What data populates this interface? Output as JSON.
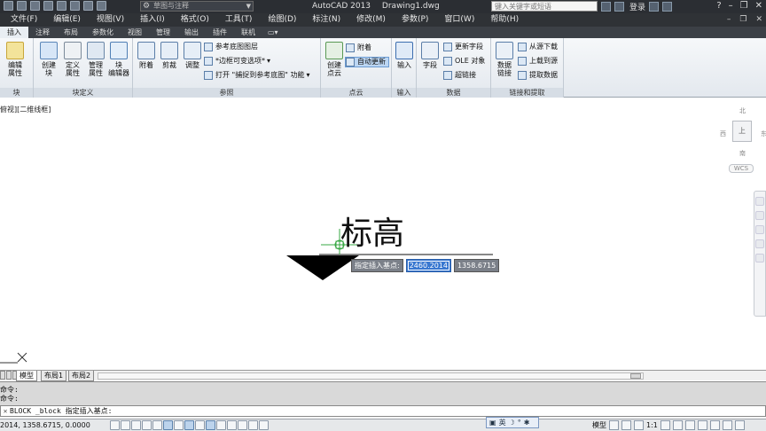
{
  "titlebar": {
    "workspace": "草图与注释",
    "app_name": "AutoCAD 2013",
    "file_name": "Drawing1.dwg",
    "search_placeholder": "键入关键字或短语",
    "login": "登录"
  },
  "menu": [
    "文件(F)",
    "编辑(E)",
    "视图(V)",
    "插入(I)",
    "格式(O)",
    "工具(T)",
    "绘图(D)",
    "标注(N)",
    "修改(M)",
    "参数(P)",
    "窗口(W)",
    "帮助(H)"
  ],
  "ribbon_tabs": [
    "插入",
    "注释",
    "布局",
    "参数化",
    "视图",
    "管理",
    "输出",
    "插件",
    "联机"
  ],
  "ribbon": {
    "block_panel_title": "块",
    "edit_attr": "编辑\n属性",
    "block_def_panel_title": "块定义",
    "create_block": "创建\n块",
    "define_attr": "定义\n属性",
    "manage_attr": "管理\n属性",
    "block_editor": "块\n编辑器",
    "reference_panel_title": "参照",
    "attach": "附着",
    "clip": "剪裁",
    "adjust": "调整",
    "underlay_layers": "参考底图图层",
    "frame_variable": "*边框可变选项*",
    "snap_underlay": "打开 \"捕捉到参考底图\" 功能",
    "pointcloud_panel_title": "点云",
    "create_pointcloud": "创建\n点云",
    "pc_attach": "附着",
    "pc_autoupdate": "自动更新",
    "import_panel_title": "输入",
    "import": "输入",
    "data_panel_title": "数据",
    "field": "字段",
    "update_fields": "更新字段",
    "ole_object": "OLE 对象",
    "hyperlink": "超链接",
    "linking_panel_title": "链接和提取",
    "data_link": "数据\n链接",
    "download_source": "从源下载",
    "upload_source": "上载到源",
    "extract_data": "提取数据"
  },
  "viewport_label": "俯视][二维线框]",
  "drawing": {
    "text": "标高",
    "tooltip_label": "指定插入基点:",
    "tooltip_x": "2460.2014",
    "tooltip_y": "1358.6715"
  },
  "viewcube": {
    "north": "北",
    "south": "南",
    "east": "东",
    "west": "西",
    "face": "上",
    "wcs": "WCS"
  },
  "layout_tabs": [
    "模型",
    "布局1",
    "布局2"
  ],
  "command_history": [
    "命令:",
    "命令:"
  ],
  "command_line": "BLOCK _block 指定插入基点:",
  "ime": {
    "lang": "英"
  },
  "statusbar": {
    "coords": "2014, 1358.6715, 0.0000",
    "model": "模型",
    "scale": "1:1"
  }
}
